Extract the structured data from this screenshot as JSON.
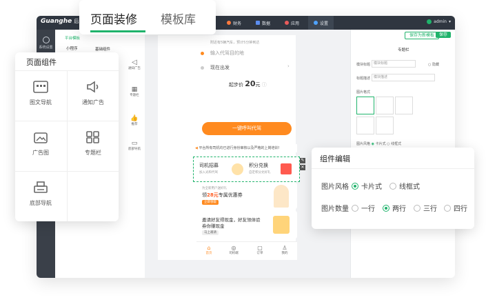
{
  "app": {
    "logo": "Guanghe",
    "logo_suffix": "后台"
  },
  "topnav": [
    {
      "label": "财务",
      "color": "#ff7a3d"
    },
    {
      "label": "数据",
      "color": "#5b8def"
    },
    {
      "label": "应用",
      "color": "#e85b5b"
    },
    {
      "label": "设置",
      "color": "#4fa3ff"
    }
  ],
  "user": {
    "name": "admin"
  },
  "sidebar": {
    "system_settings": "系统设置"
  },
  "subnav": {
    "item1": "平台模板",
    "item2": "小程序"
  },
  "components_column": {
    "tab": "基础组件",
    "items": [
      "通知广告",
      "专题栏",
      "推荐",
      "底部导航"
    ]
  },
  "header_buttons": {
    "save_template": "保存为新模板",
    "save": "保存"
  },
  "tabs": {
    "active": "页面装修",
    "inactive": "模板库"
  },
  "component_panel": {
    "title": "页面组件",
    "items": [
      "图文导航",
      "通知广告",
      "广告图",
      "专题栏",
      "底部导航"
    ]
  },
  "phone": {
    "hint": "附近有5辆汽车，预计5分钟到达",
    "destination_placeholder": "输入代驾目的地",
    "depart_now": "现在出发",
    "price_prefix": "起步价",
    "price": "20",
    "price_unit": "元",
    "call_button": "一键呼叫代驾",
    "notice": "平台所有司机均已进行身份审核以及严格的上岗培训!",
    "card_left_title": "司机招募",
    "card_left_sub": "加入光和代驾",
    "card_right_title": "积分兑换",
    "card_right_sub": "自定积分兑好礼",
    "coupon_small": "为全新用户送好礼",
    "coupon_main_prefix": "领",
    "coupon_amount": "28元",
    "coupon_main_suffix": "专属优惠券",
    "coupon_btn": "立即领取",
    "invite_line1": "邀请好友得现金，好友领体验",
    "invite_line2": "券你赚现金",
    "invite_btn": "马上邀请",
    "bottom_nav": [
      "首页",
      "司机端",
      "订单",
      "我的"
    ]
  },
  "right_panel": {
    "title": "专题栏",
    "label_title": "模块标题",
    "placeholder_title": "模块标题",
    "hide": "隐藏",
    "label_desc": "标题描述",
    "placeholder_desc": "模块描述",
    "image_style_label": "图片格式",
    "image_style_small": "图片风格",
    "opt_card": "卡片式",
    "opt_line": "线框式"
  },
  "edit_panel": {
    "title": "组件编辑",
    "style_label": "图片风格",
    "style_options": [
      "卡片式",
      "线框式"
    ],
    "count_label": "图片数量",
    "count_options": [
      "一行",
      "两行",
      "三行",
      "四行"
    ]
  },
  "colors": {
    "accent": "#1fb36b",
    "orange": "#ff8a1f",
    "topbar": "#2f3640"
  }
}
